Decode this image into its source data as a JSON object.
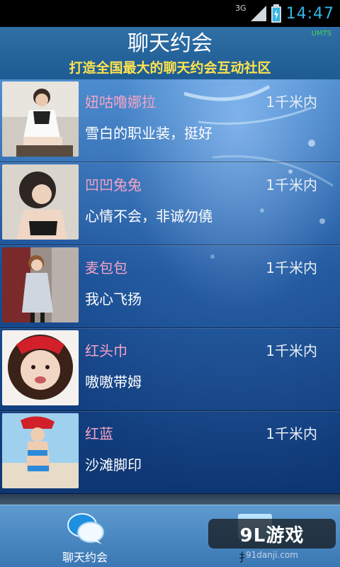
{
  "status_bar": {
    "network": "3G",
    "time": "14:47"
  },
  "header": {
    "title": "聊天约会",
    "subtitle": "打造全国最大的聊天约会互动社区",
    "network_indicator": "UMTS"
  },
  "list": {
    "items": [
      {
        "name": "妞咕噜娜拉",
        "distance": "1千米内",
        "status": "雪白的职业装，挺好"
      },
      {
        "name": "凹凹兔兔",
        "distance": "1千米内",
        "status": "心情不会，非诚勿僥"
      },
      {
        "name": "麦包包",
        "distance": "1千米内",
        "status": "我心飞扬"
      },
      {
        "name": "红头巾",
        "distance": "1千米内",
        "status": "嗷嗷带姆"
      },
      {
        "name": "红蓝",
        "distance": "1千米内",
        "status": "沙滩脚印"
      }
    ]
  },
  "tabbar": {
    "tab1_label": "聊天约会",
    "tab2_label": "扌"
  },
  "watermark": {
    "brand": "9L游戏",
    "site": "91danji.com"
  },
  "colors": {
    "name": "#f5a3c7",
    "subtitle": "#ffe34d",
    "clock": "#33b5e5",
    "umts": "#49d657"
  },
  "icons": {
    "signal": "signal-icon",
    "battery": "battery-charging-icon",
    "chat": "chat-bubbles-icon"
  }
}
